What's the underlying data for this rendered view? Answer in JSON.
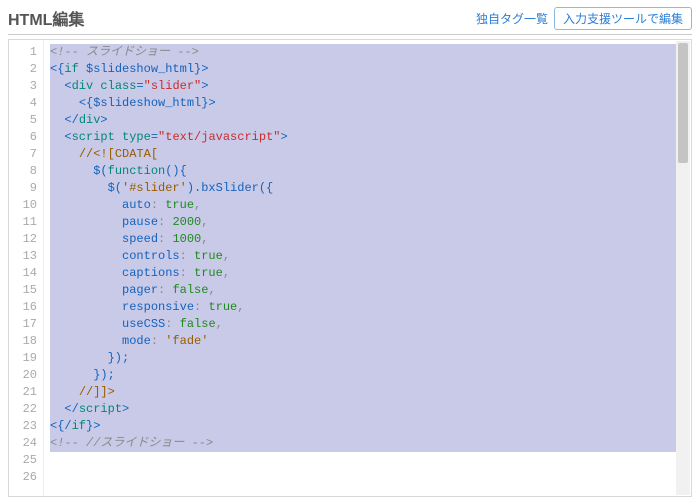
{
  "header": {
    "title": "HTML編集",
    "tag_list_link": "独自タグ一覧",
    "edit_tool_button": "入力支援ツールで編集"
  },
  "editor": {
    "total_lines": 26,
    "selected_range": [
      1,
      24
    ],
    "lines": [
      {
        "n": 1,
        "tokens": [
          {
            "t": "<!-- スライドショー -->",
            "c": "c-gray"
          }
        ]
      },
      {
        "n": 2,
        "tokens": [
          {
            "t": "<{",
            "c": "c-blue"
          },
          {
            "t": "if",
            "c": "c-teal"
          },
          {
            "t": " $slideshow_html",
            "c": "c-blue"
          },
          {
            "t": "}>",
            "c": "c-blue"
          }
        ]
      },
      {
        "n": 3,
        "tokens": [
          {
            "t": "  ",
            "c": ""
          },
          {
            "t": "<",
            "c": "c-blue"
          },
          {
            "t": "div",
            "c": "c-teal"
          },
          {
            "t": " class",
            "c": "c-teal"
          },
          {
            "t": "=",
            "c": "c-blue"
          },
          {
            "t": "\"slider\"",
            "c": "c-red"
          },
          {
            "t": ">",
            "c": "c-blue"
          }
        ]
      },
      {
        "n": 4,
        "tokens": [
          {
            "t": "    ",
            "c": ""
          },
          {
            "t": "<{",
            "c": "c-blue"
          },
          {
            "t": "$slideshow_html",
            "c": "c-blue"
          },
          {
            "t": "}>",
            "c": "c-blue"
          }
        ]
      },
      {
        "n": 5,
        "tokens": [
          {
            "t": "  ",
            "c": ""
          },
          {
            "t": "</",
            "c": "c-blue"
          },
          {
            "t": "div",
            "c": "c-teal"
          },
          {
            "t": ">",
            "c": "c-blue"
          }
        ]
      },
      {
        "n": 6,
        "tokens": [
          {
            "t": "  ",
            "c": ""
          },
          {
            "t": "<",
            "c": "c-blue"
          },
          {
            "t": "script",
            "c": "c-teal"
          },
          {
            "t": " type",
            "c": "c-teal"
          },
          {
            "t": "=",
            "c": "c-blue"
          },
          {
            "t": "\"text/javascript\"",
            "c": "c-red"
          },
          {
            "t": ">",
            "c": "c-blue"
          }
        ]
      },
      {
        "n": 7,
        "tokens": [
          {
            "t": "    ",
            "c": ""
          },
          {
            "t": "//<![CDATA[",
            "c": "c-brown"
          }
        ]
      },
      {
        "n": 8,
        "tokens": [
          {
            "t": "      ",
            "c": ""
          },
          {
            "t": "$(",
            "c": "c-blue"
          },
          {
            "t": "function",
            "c": "c-teal"
          },
          {
            "t": "(){",
            "c": "c-blue"
          }
        ]
      },
      {
        "n": 9,
        "tokens": [
          {
            "t": "        ",
            "c": ""
          },
          {
            "t": "$(",
            "c": "c-blue"
          },
          {
            "t": "'#slider'",
            "c": "c-brown"
          },
          {
            "t": ").",
            "c": "c-blue"
          },
          {
            "t": "bxSlider",
            "c": "c-blue"
          },
          {
            "t": "({",
            "c": "c-blue"
          }
        ]
      },
      {
        "n": 10,
        "tokens": [
          {
            "t": "          ",
            "c": ""
          },
          {
            "t": "auto",
            "c": "c-blue"
          },
          {
            "t": ": ",
            "c": "c-gray2"
          },
          {
            "t": "true",
            "c": "c-green"
          },
          {
            "t": ",",
            "c": "c-gray2"
          }
        ]
      },
      {
        "n": 11,
        "tokens": [
          {
            "t": "          ",
            "c": ""
          },
          {
            "t": "pause",
            "c": "c-blue"
          },
          {
            "t": ": ",
            "c": "c-gray2"
          },
          {
            "t": "2000",
            "c": "c-green"
          },
          {
            "t": ",",
            "c": "c-gray2"
          }
        ]
      },
      {
        "n": 12,
        "tokens": [
          {
            "t": "          ",
            "c": ""
          },
          {
            "t": "speed",
            "c": "c-blue"
          },
          {
            "t": ": ",
            "c": "c-gray2"
          },
          {
            "t": "1000",
            "c": "c-green"
          },
          {
            "t": ",",
            "c": "c-gray2"
          }
        ]
      },
      {
        "n": 13,
        "tokens": [
          {
            "t": "          ",
            "c": ""
          },
          {
            "t": "controls",
            "c": "c-blue"
          },
          {
            "t": ": ",
            "c": "c-gray2"
          },
          {
            "t": "true",
            "c": "c-green"
          },
          {
            "t": ",",
            "c": "c-gray2"
          }
        ]
      },
      {
        "n": 14,
        "tokens": [
          {
            "t": "          ",
            "c": ""
          },
          {
            "t": "captions",
            "c": "c-blue"
          },
          {
            "t": ": ",
            "c": "c-gray2"
          },
          {
            "t": "true",
            "c": "c-green"
          },
          {
            "t": ",",
            "c": "c-gray2"
          }
        ]
      },
      {
        "n": 15,
        "tokens": [
          {
            "t": "          ",
            "c": ""
          },
          {
            "t": "pager",
            "c": "c-blue"
          },
          {
            "t": ": ",
            "c": "c-gray2"
          },
          {
            "t": "false",
            "c": "c-green"
          },
          {
            "t": ",",
            "c": "c-gray2"
          }
        ]
      },
      {
        "n": 16,
        "tokens": [
          {
            "t": "          ",
            "c": ""
          },
          {
            "t": "responsive",
            "c": "c-blue"
          },
          {
            "t": ": ",
            "c": "c-gray2"
          },
          {
            "t": "true",
            "c": "c-green"
          },
          {
            "t": ",",
            "c": "c-gray2"
          }
        ]
      },
      {
        "n": 17,
        "tokens": [
          {
            "t": "          ",
            "c": ""
          },
          {
            "t": "useCSS",
            "c": "c-blue"
          },
          {
            "t": ": ",
            "c": "c-gray2"
          },
          {
            "t": "false",
            "c": "c-green"
          },
          {
            "t": ",",
            "c": "c-gray2"
          }
        ]
      },
      {
        "n": 18,
        "tokens": [
          {
            "t": "          ",
            "c": ""
          },
          {
            "t": "mode",
            "c": "c-blue"
          },
          {
            "t": ": ",
            "c": "c-gray2"
          },
          {
            "t": "'fade'",
            "c": "c-brown"
          }
        ]
      },
      {
        "n": 19,
        "tokens": [
          {
            "t": "        ",
            "c": ""
          },
          {
            "t": "});",
            "c": "c-blue"
          }
        ]
      },
      {
        "n": 20,
        "tokens": [
          {
            "t": "      ",
            "c": ""
          },
          {
            "t": "});",
            "c": "c-blue"
          }
        ]
      },
      {
        "n": 21,
        "tokens": [
          {
            "t": "    ",
            "c": ""
          },
          {
            "t": "//]]>",
            "c": "c-brown"
          }
        ]
      },
      {
        "n": 22,
        "tokens": [
          {
            "t": "  ",
            "c": ""
          },
          {
            "t": "</",
            "c": "c-blue"
          },
          {
            "t": "script",
            "c": "c-teal"
          },
          {
            "t": ">",
            "c": "c-blue"
          }
        ]
      },
      {
        "n": 23,
        "tokens": [
          {
            "t": "<{/",
            "c": "c-blue"
          },
          {
            "t": "if",
            "c": "c-teal"
          },
          {
            "t": "}>",
            "c": "c-blue"
          }
        ]
      },
      {
        "n": 24,
        "tokens": [
          {
            "t": "<!-- //スライドショー -->",
            "c": "c-gray"
          }
        ]
      },
      {
        "n": 25,
        "tokens": [
          {
            "t": "",
            "c": ""
          }
        ]
      },
      {
        "n": 26,
        "tokens": [
          {
            "t": "",
            "c": ""
          }
        ]
      }
    ]
  }
}
